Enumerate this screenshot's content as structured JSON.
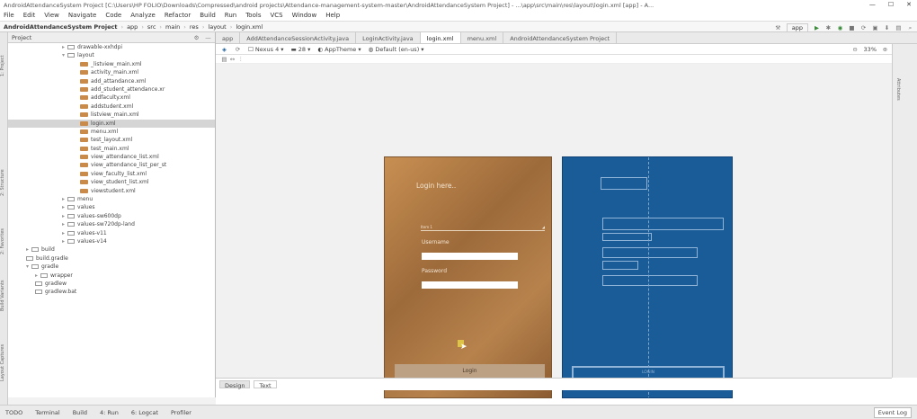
{
  "window": {
    "title": "AndroidAttendanceSystem Project [C:\\Users\\HP FOLIO\\Downloads\\Compressed\\android projects\\Attendance-management-system-master\\AndroidAttendanceSystem Project] - ...\\app\\src\\main\\res\\layout\\login.xml [app] - A...",
    "min": "—",
    "max": "☐",
    "close": "✕"
  },
  "menu": [
    "File",
    "Edit",
    "View",
    "Navigate",
    "Code",
    "Analyze",
    "Refactor",
    "Build",
    "Run",
    "Tools",
    "VCS",
    "Window",
    "Help"
  ],
  "breadcrumb": [
    "AndroidAttendanceSystem Project",
    "app",
    "src",
    "main",
    "res",
    "layout",
    "login.xml"
  ],
  "toolbar": {
    "config": "app"
  },
  "project_panel": {
    "header": "Project",
    "tree": [
      {
        "label": "drawable-xxhdpi",
        "indent": 60,
        "type": "folder",
        "arrow": "▸"
      },
      {
        "label": "layout",
        "indent": 60,
        "type": "folder",
        "arrow": "▾"
      },
      {
        "label": "_listview_main.xml",
        "indent": 80,
        "type": "xml"
      },
      {
        "label": "activity_main.xml",
        "indent": 80,
        "type": "xml"
      },
      {
        "label": "add_attandance.xml",
        "indent": 80,
        "type": "xml"
      },
      {
        "label": "add_student_attendance.xr",
        "indent": 80,
        "type": "xml"
      },
      {
        "label": "addfaculty.xml",
        "indent": 80,
        "type": "xml"
      },
      {
        "label": "addstudent.xml",
        "indent": 80,
        "type": "xml"
      },
      {
        "label": "listview_main.xml",
        "indent": 80,
        "type": "xml"
      },
      {
        "label": "login.xml",
        "indent": 80,
        "type": "xml",
        "selected": true
      },
      {
        "label": "menu.xml",
        "indent": 80,
        "type": "xml"
      },
      {
        "label": "test_layout.xml",
        "indent": 80,
        "type": "xml"
      },
      {
        "label": "test_main.xml",
        "indent": 80,
        "type": "xml"
      },
      {
        "label": "view_attendance_list.xml",
        "indent": 80,
        "type": "xml"
      },
      {
        "label": "view_attendance_list_per_st",
        "indent": 80,
        "type": "xml"
      },
      {
        "label": "view_faculty_list.xml",
        "indent": 80,
        "type": "xml"
      },
      {
        "label": "view_student_list.xml",
        "indent": 80,
        "type": "xml"
      },
      {
        "label": "viewstudent.xml",
        "indent": 80,
        "type": "xml"
      },
      {
        "label": "menu",
        "indent": 60,
        "type": "folder",
        "arrow": "▸"
      },
      {
        "label": "values",
        "indent": 60,
        "type": "folder",
        "arrow": "▸"
      },
      {
        "label": "values-sw600dp",
        "indent": 60,
        "type": "folder",
        "arrow": "▸"
      },
      {
        "label": "values-sw720dp-land",
        "indent": 60,
        "type": "folder",
        "arrow": "▸"
      },
      {
        "label": "values-v11",
        "indent": 60,
        "type": "folder",
        "arrow": "▸"
      },
      {
        "label": "values-v14",
        "indent": 60,
        "type": "folder",
        "arrow": "▸"
      },
      {
        "label": "build",
        "indent": 20,
        "type": "folder",
        "arrow": "▸"
      },
      {
        "label": "build.gradle",
        "indent": 20,
        "type": "file"
      },
      {
        "label": "gradle",
        "indent": 20,
        "type": "folder",
        "arrow": "▾"
      },
      {
        "label": "wrapper",
        "indent": 30,
        "type": "folder",
        "arrow": "▸"
      },
      {
        "label": "gradlew",
        "indent": 30,
        "type": "file"
      },
      {
        "label": "gradlew.bat",
        "indent": 30,
        "type": "file"
      }
    ]
  },
  "side_tabs": [
    "1: Project",
    "2: Structure",
    "2: Favorites",
    "Build Variants",
    "Layout Captures"
  ],
  "editor_tabs": [
    {
      "label": "app",
      "active": false
    },
    {
      "label": "AddAttendanceSessionActivity.java",
      "active": false
    },
    {
      "label": "LoginActivity.java",
      "active": false
    },
    {
      "label": "login.xml",
      "active": true
    },
    {
      "label": "menu.xml",
      "active": false
    },
    {
      "label": "AndroidAttendanceSystem Project",
      "active": false
    }
  ],
  "design_toolbar": {
    "device": "Nexus 4",
    "api": "28",
    "theme": "AppTheme",
    "locale": "Default (en-us)",
    "zoom": "33%"
  },
  "attributes_label": "Attributes",
  "phone": {
    "title": "Login here..",
    "spinner": "Item 1",
    "username_label": "Username",
    "password_label": "Password",
    "button": "Login"
  },
  "blueprint": {
    "button": "LOGIN"
  },
  "bottom_tabs": [
    {
      "label": "Design",
      "active": true
    },
    {
      "label": "Text",
      "active": false
    }
  ],
  "status_bar": {
    "items": [
      "TODO",
      "Terminal",
      "Build",
      "4: Run",
      "6: Logcat",
      "Profiler"
    ],
    "event_log": "Event Log"
  }
}
